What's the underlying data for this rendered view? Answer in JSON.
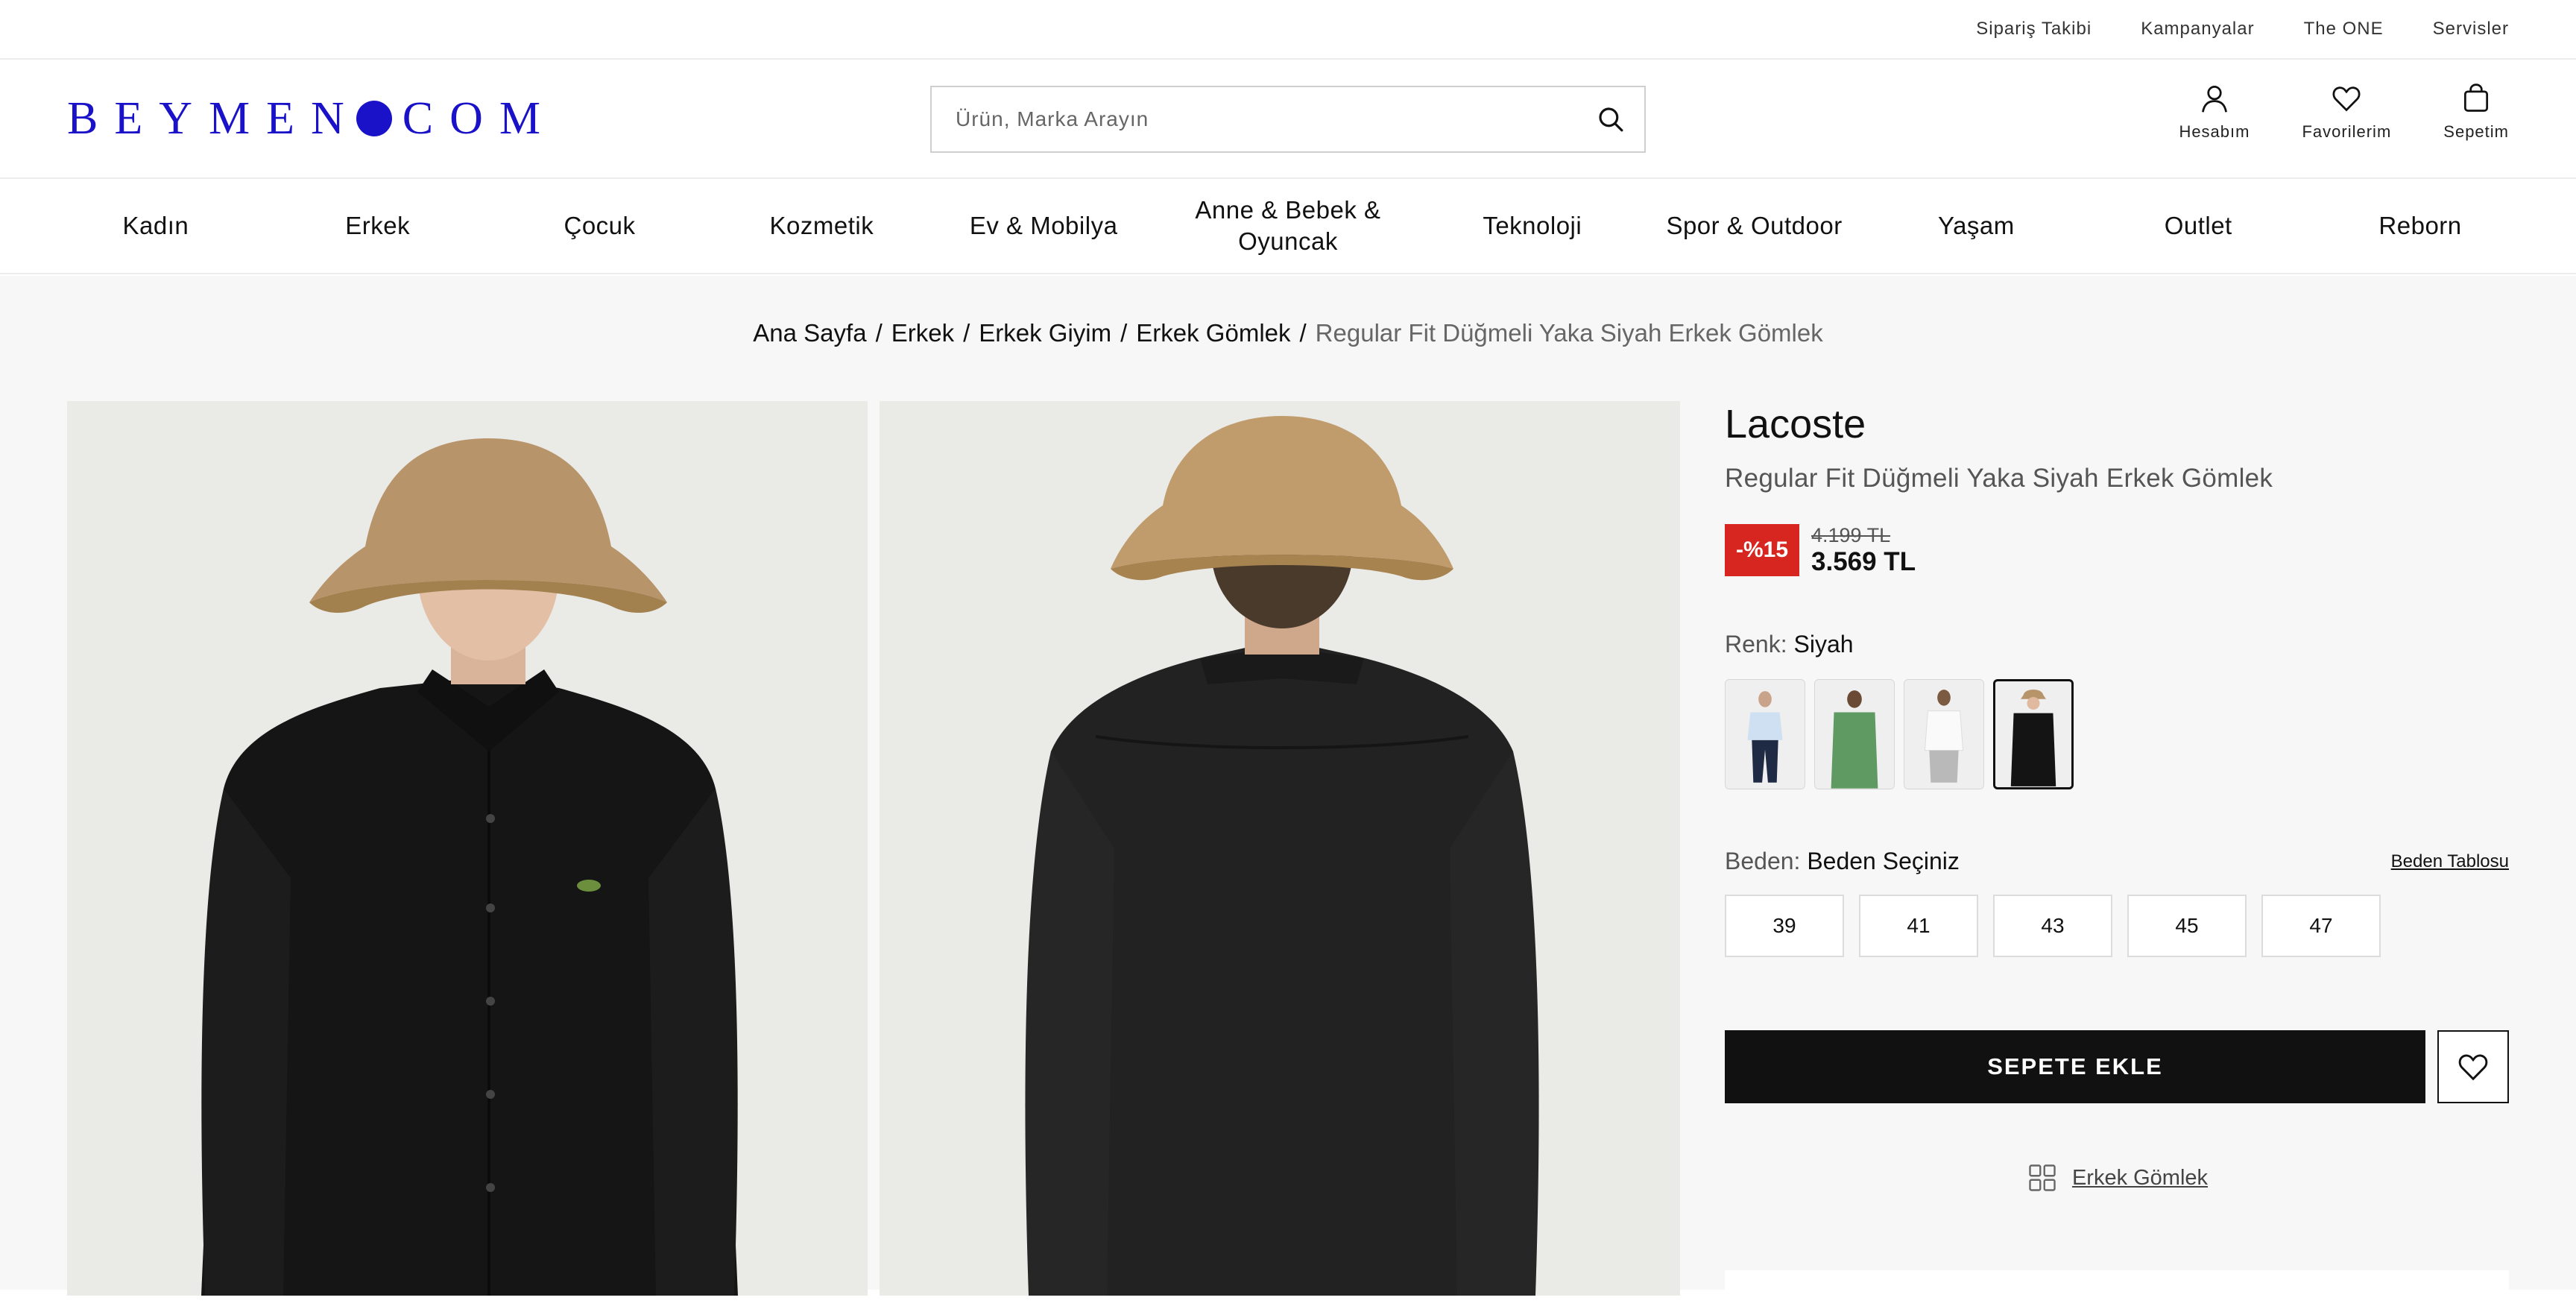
{
  "topbar": {
    "links": [
      "Sipariş Takibi",
      "Kampanyalar",
      "The ONE",
      "Servisler"
    ]
  },
  "header": {
    "logo_left": "BEYMEN",
    "logo_right": "COM",
    "search_placeholder": "Ürün, Marka Arayın",
    "account_label": "Hesabım",
    "favorites_label": "Favorilerim",
    "cart_label": "Sepetim"
  },
  "nav": {
    "items": [
      "Kadın",
      "Erkek",
      "Çocuk",
      "Kozmetik",
      "Ev & Mobilya",
      "Anne & Bebek & Oyuncak",
      "Teknoloji",
      "Spor & Outdoor",
      "Yaşam",
      "Outlet",
      "Reborn"
    ]
  },
  "breadcrumb": {
    "items": [
      "Ana Sayfa",
      "Erkek",
      "Erkek Giyim",
      "Erkek Gömlek"
    ],
    "separator": "/",
    "current": "Regular Fit Düğmeli Yaka Siyah Erkek Gömlek"
  },
  "product": {
    "brand": "Lacoste",
    "title": "Regular Fit Düğmeli Yaka Siyah Erkek Gömlek",
    "discount": "-%15",
    "old_price": "4.199 TL",
    "price": "3.569 TL",
    "color_label": "Renk:",
    "color_value": "Siyah",
    "swatch_colors": [
      "#cfe0f2",
      "#5f9a62",
      "#f1f1f1",
      "#141414"
    ],
    "size_label": "Beden:",
    "size_value": "Beden Seçiniz",
    "size_chart": "Beden Tablosu",
    "sizes": [
      "39",
      "41",
      "43",
      "45",
      "47"
    ],
    "add_to_cart": "SEPETE EKLE",
    "category_link": "Erkek Gömlek"
  },
  "colors": {
    "logo_blue": "#1a12c8",
    "discount_red": "#d6261f",
    "button_black": "#111111"
  }
}
